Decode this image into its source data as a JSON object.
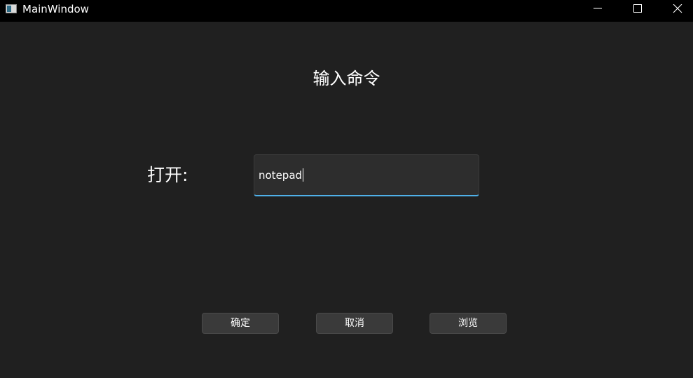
{
  "window": {
    "title": "MainWindow",
    "controls": {
      "minimize_icon": "minimize-icon",
      "maximize_icon": "maximize-icon",
      "close_icon": "close-icon"
    }
  },
  "main": {
    "heading": "输入命令",
    "open_label": "打开:",
    "command_input": {
      "value": "notepad",
      "accent_color": "#4fb0e8"
    },
    "buttons": {
      "ok": "确定",
      "cancel": "取消",
      "browse": "浏览"
    }
  },
  "colors": {
    "background": "#202020",
    "titlebar": "#000000",
    "button_bg": "#3a3a3a",
    "input_bg": "#2d2d2d"
  }
}
